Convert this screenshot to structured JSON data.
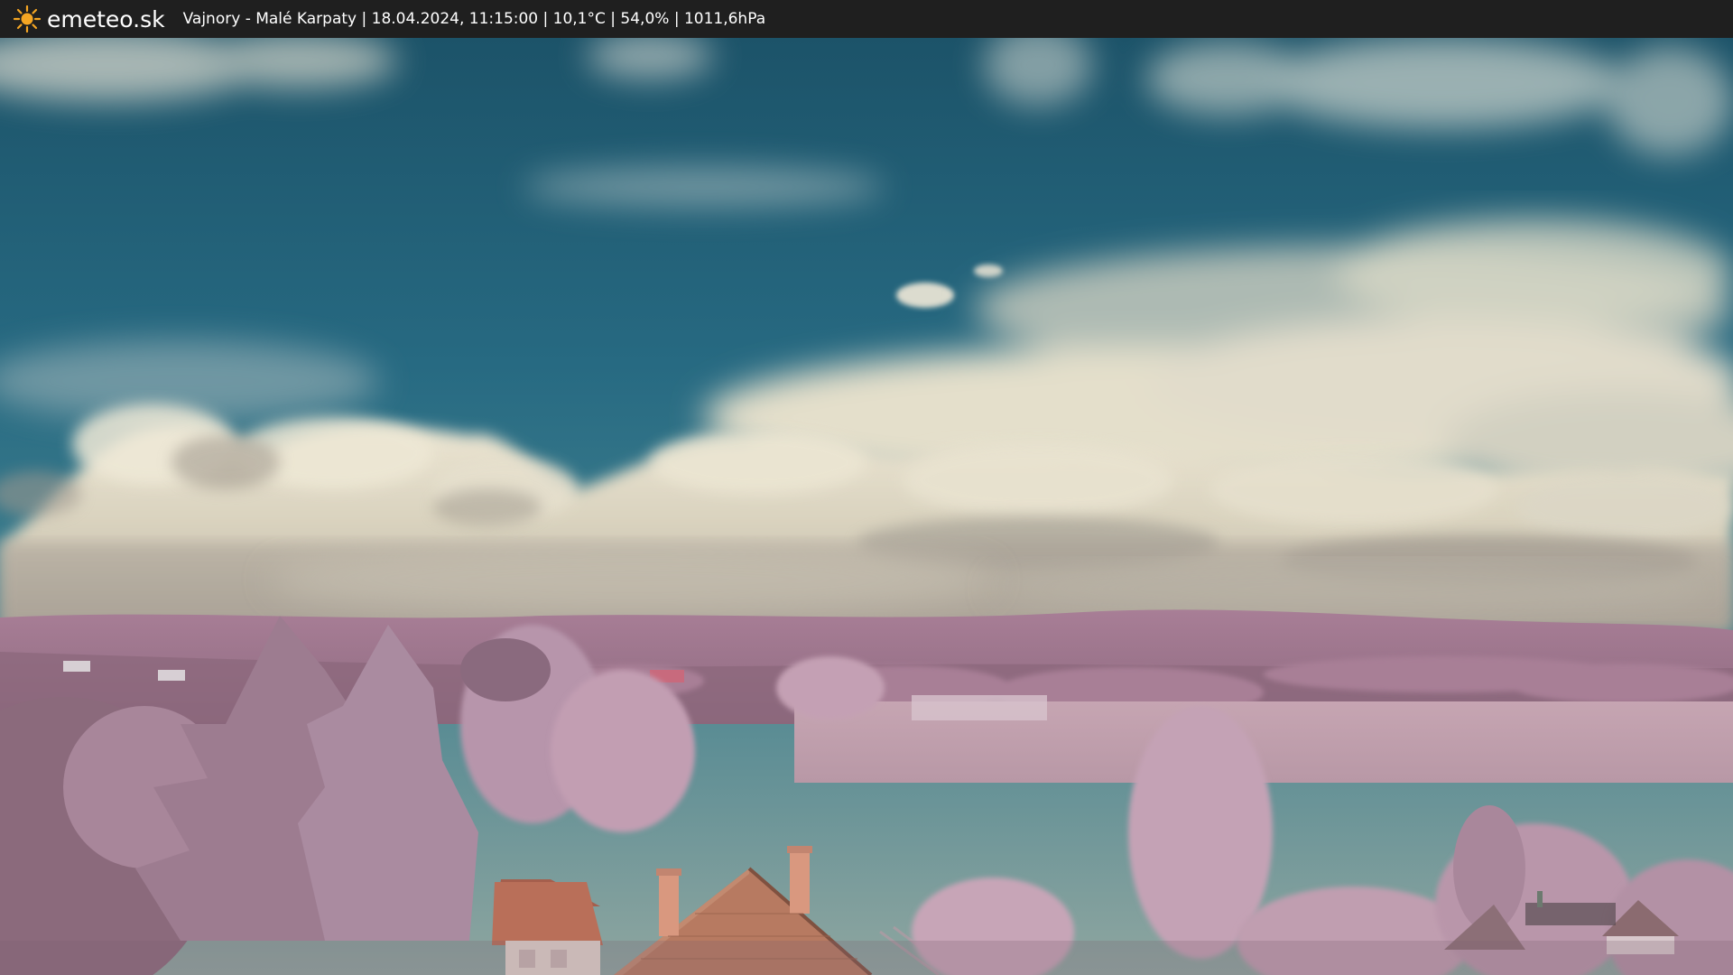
{
  "header": {
    "brand": "emeteo.sk",
    "brand_icon": "sun-icon",
    "caption": "Vajnory - Malé Karpaty | 18.04.2024, 11:15:00 | 10,1°C | 54,0% | 1011,6hPa"
  },
  "colors": {
    "bar_background": "#1f1f1f",
    "text": "#ffffff",
    "sun": "#f5a623",
    "sky_top": "#1f5a70",
    "sky_mid": "#2a6f86",
    "cloud": "#e8e2cf",
    "foliage": "#b88aa0",
    "roof": "#b5725a"
  }
}
